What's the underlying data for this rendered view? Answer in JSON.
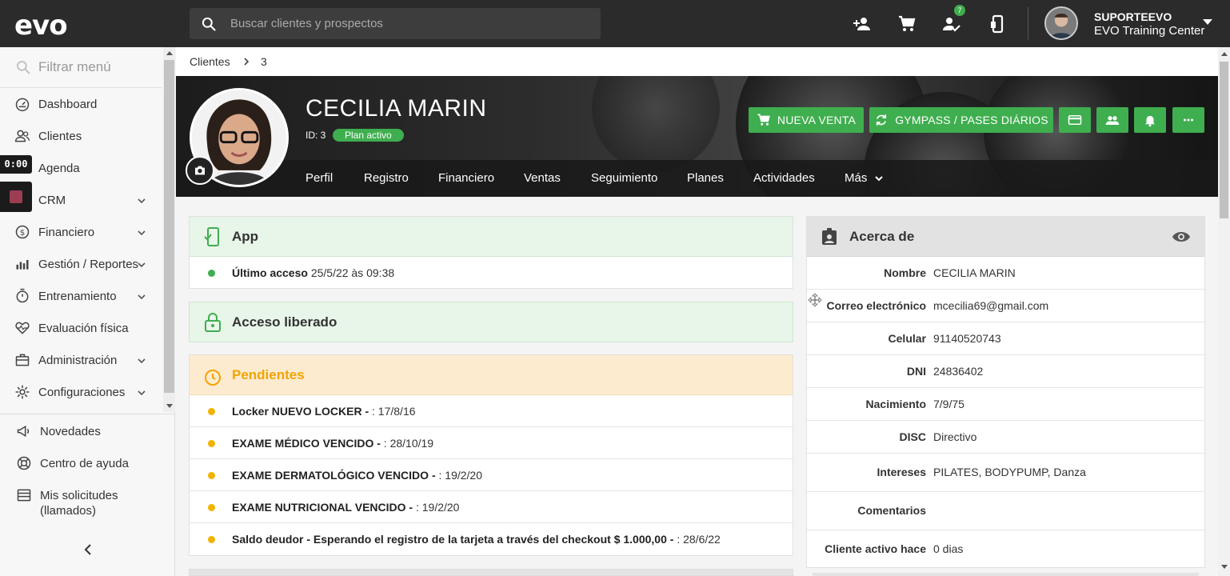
{
  "topbar": {
    "logo": "evo",
    "search_placeholder": "Buscar clientes y prospectos",
    "notification_count": "7",
    "user_name": "SUPORTEEVO",
    "user_org": "EVO Training Center"
  },
  "sidebar": {
    "filter_placeholder": "Filtrar menú",
    "clock_chip": "0:00",
    "items": [
      {
        "label": "Dashboard",
        "icon": "dashboard-icon"
      },
      {
        "label": "Clientes",
        "icon": "users-icon"
      },
      {
        "label": "Agenda",
        "icon": "calendar-icon"
      },
      {
        "label": "CRM",
        "icon": "crm-icon"
      },
      {
        "label": "Financiero",
        "icon": "dollar-icon"
      },
      {
        "label": "Gestión / Reportes",
        "icon": "chart-icon"
      },
      {
        "label": "Entrenamiento",
        "icon": "timer-icon"
      },
      {
        "label": "Evaluación física",
        "icon": "heart-icon"
      },
      {
        "label": "Administración",
        "icon": "briefcase-icon"
      },
      {
        "label": "Configuraciones",
        "icon": "gear-icon"
      }
    ],
    "bottom_items": [
      {
        "label": "Novedades",
        "icon": "megaphone-icon"
      },
      {
        "label": "Centro de ayuda",
        "icon": "lifebuoy-icon"
      },
      {
        "label": "Mis solicitudes",
        "label2": "(llamados)",
        "icon": "tickets-icon"
      }
    ]
  },
  "breadcrumb": {
    "root": "Clientes",
    "current": "3"
  },
  "profile": {
    "name": "CECILIA MARIN",
    "id_label": "ID: 3",
    "plan_status": "Plan activo",
    "buttons": {
      "new_sale": "NUEVA VENTA",
      "gympass": "GYMPASS / PASES DIÁRIOS"
    },
    "tabs": [
      "Perfil",
      "Registro",
      "Financiero",
      "Ventas",
      "Seguimiento",
      "Planes",
      "Actividades",
      "Más"
    ]
  },
  "app_card": {
    "title": "App",
    "last_access_label": "Último acceso",
    "last_access_value": "25/5/22 às 09:38"
  },
  "access_card": {
    "title": "Acceso liberado"
  },
  "pending_card": {
    "title": "Pendientes",
    "items": [
      {
        "bold": "Locker NUEVO LOCKER -",
        "rest": " : 17/8/16"
      },
      {
        "bold": "EXAME MÉDICO VENCIDO -",
        "rest": " : 28/10/19"
      },
      {
        "bold": "EXAME DERMATOLÓGICO VENCIDO -",
        "rest": " : 19/2/20"
      },
      {
        "bold": "EXAME NUTRICIONAL VENCIDO -",
        "rest": " : 19/2/20"
      },
      {
        "bold": "Saldo deudor - Esperando el registro de la tarjeta a través del checkout $ 1.000,00 -",
        "rest": " : 28/6/22"
      }
    ]
  },
  "about_card": {
    "title": "Acerca de",
    "fields": [
      {
        "label": "Nombre",
        "value": "CECILIA MARIN"
      },
      {
        "label": "Correo electrónico",
        "value": "mcecilia69@gmail.com"
      },
      {
        "label": "Celular",
        "value": "91140520743"
      },
      {
        "label": "DNI",
        "value": "24836402"
      },
      {
        "label": "Nacimiento",
        "value": "7/9/75"
      },
      {
        "label": "DISC",
        "value": "Directivo"
      },
      {
        "label": "Intereses",
        "value": "PILATES, BODYPUMP, Danza"
      },
      {
        "label": "Comentarios",
        "value": ""
      },
      {
        "label": "Cliente activo hace",
        "value": "0 dias"
      }
    ]
  },
  "colors": {
    "topbar": "#2b2b2b",
    "accent_green": "#3fae4f",
    "pending_bg": "#fdebd0",
    "pending_text": "#f0a500",
    "app_bg": "#e8f5e9"
  }
}
